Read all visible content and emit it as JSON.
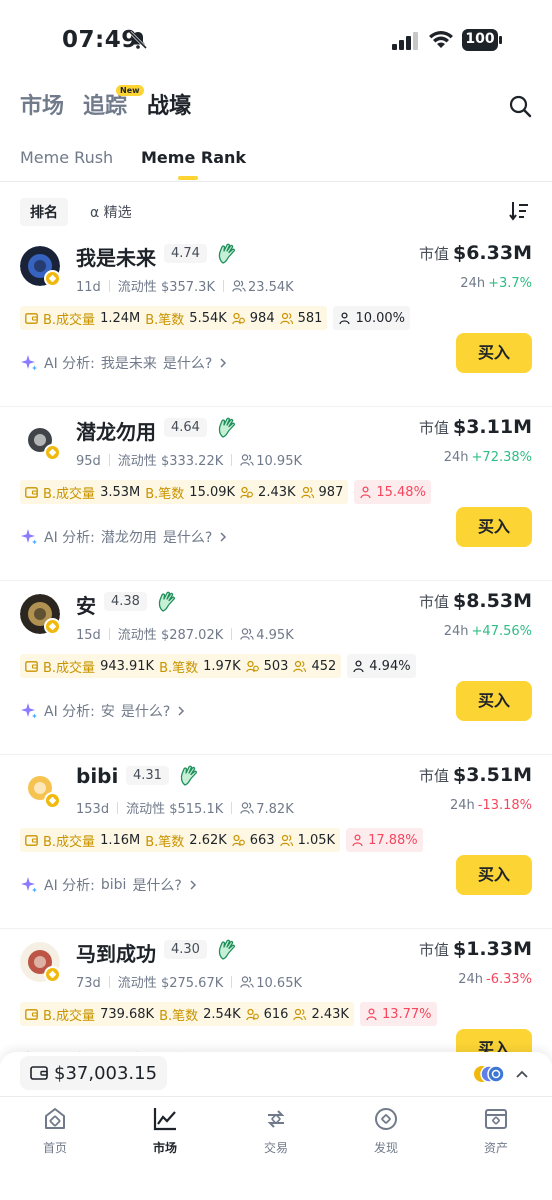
{
  "status_bar": {
    "time": "07:49",
    "battery": "100"
  },
  "top_nav": {
    "tabs": [
      "市场",
      "追踪",
      "战壕"
    ],
    "new_badge": "New"
  },
  "sub_tabs": [
    "Meme Rush",
    "Meme Rank"
  ],
  "filters": {
    "rank": "排名",
    "alpha": "α 精选"
  },
  "labels": {
    "market_cap": "市值",
    "period": "24h",
    "liquidity": "流动性",
    "b_volume": "B.成交量",
    "b_trades": "B.笔数",
    "ai_prefix": "AI 分析:",
    "ai_suffix": "是什么?",
    "buy": "买入"
  },
  "tokens": [
    {
      "name": "我是未来",
      "score": "4.74",
      "age": "11d",
      "liquidity": "$357.3K",
      "holders": "23.54K",
      "market_cap": "$6.33M",
      "change": "+3.7%",
      "b_volume": "1.24M",
      "b_trades": "5.54K",
      "traders": "984",
      "users": "581",
      "top_holder_pct": "10.00%",
      "top_holder_warn": false
    },
    {
      "name": "潜龙勿用",
      "score": "4.64",
      "age": "95d",
      "liquidity": "$333.22K",
      "holders": "10.95K",
      "market_cap": "$3.11M",
      "change": "+72.38%",
      "b_volume": "3.53M",
      "b_trades": "15.09K",
      "traders": "2.43K",
      "users": "987",
      "top_holder_pct": "15.48%",
      "top_holder_warn": true
    },
    {
      "name": "安",
      "score": "4.38",
      "age": "15d",
      "liquidity": "$287.02K",
      "holders": "4.95K",
      "market_cap": "$8.53M",
      "change": "+47.56%",
      "b_volume": "943.91K",
      "b_trades": "1.97K",
      "traders": "503",
      "users": "452",
      "top_holder_pct": "4.94%",
      "top_holder_warn": false
    },
    {
      "name": "bibi",
      "score": "4.31",
      "age": "153d",
      "liquidity": "$515.1K",
      "holders": "7.82K",
      "market_cap": "$3.51M",
      "change": "-13.18%",
      "b_volume": "1.16M",
      "b_trades": "2.62K",
      "traders": "663",
      "users": "1.05K",
      "top_holder_pct": "17.88%",
      "top_holder_warn": true
    },
    {
      "name": "马到成功",
      "score": "4.30",
      "age": "73d",
      "liquidity": "$275.67K",
      "holders": "10.65K",
      "market_cap": "$1.33M",
      "change": "-6.33%",
      "b_volume": "739.68K",
      "b_trades": "2.54K",
      "traders": "616",
      "users": "2.43K",
      "top_holder_pct": "13.77%",
      "top_holder_warn": true
    }
  ],
  "wallet": {
    "balance": "$37,003.15"
  },
  "bottom_nav": [
    "首页",
    "市场",
    "交易",
    "发现",
    "资产"
  ],
  "colors": {
    "accent": "#fcd535",
    "up": "#2ebd85",
    "down": "#f6465d"
  }
}
